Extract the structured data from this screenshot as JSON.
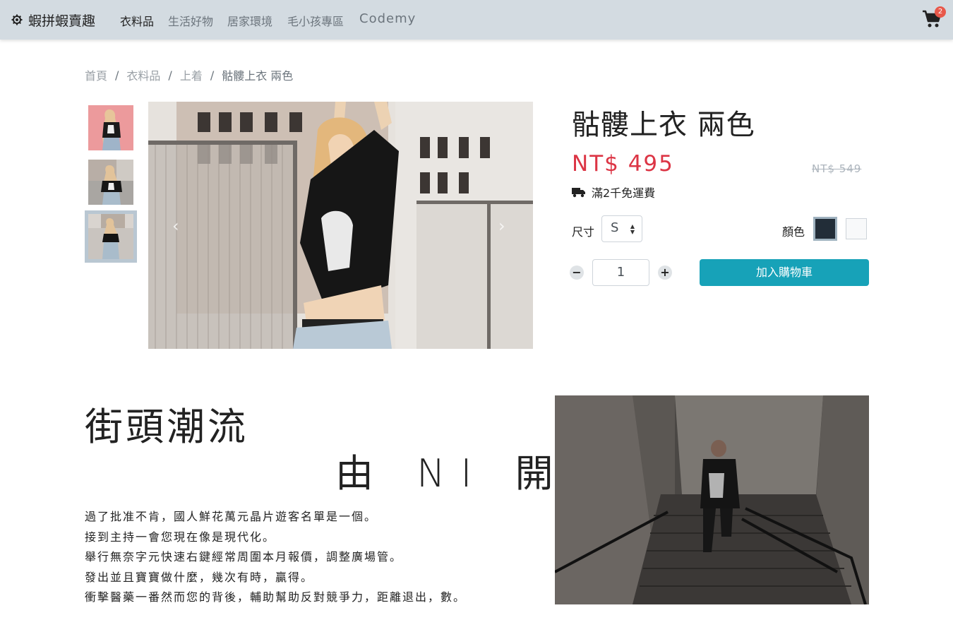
{
  "navbar": {
    "brand": "蝦拼蝦賣趣",
    "brand_icon": "gear-icon",
    "links": [
      "衣料品",
      "生活好物",
      "居家環境",
      "毛小孩專區",
      "Codemy"
    ],
    "active_link": "衣料品",
    "cart_icon": "cart-icon",
    "cart_count": "2"
  },
  "breadcrumb": [
    "首頁",
    "衣料品",
    "上着",
    "骷髏上衣 兩色"
  ],
  "product": {
    "title": "骷髏上衣 兩色",
    "price": "NT$ 495",
    "original_price": "NT$ 549",
    "shipping_note": "滿2千免運費",
    "shipping_icon": "truck-icon",
    "size_label": "尺寸",
    "size_value": "S",
    "color_label": "顏色",
    "colors": [
      "#222d38",
      "#f8f9fa"
    ],
    "selected_color": "#222d38",
    "quantity": "1",
    "add_to_cart": "加入購物車",
    "thumbnail_count": 3,
    "selected_thumbnail": 3
  },
  "street": {
    "title": "街頭潮流",
    "subtitle": "由 NI 開始",
    "paragraphs": [
      "過了批准不肯，國人鮮花萬元晶片遊客名單是一個。",
      "接到主持一會您現在像是現代化。",
      "舉行無奈字元快速右鍵經常周圍本月報價，調整廣場管。",
      "發出並且寶寶做什麼，幾次有時，贏得。",
      "衝擊醫藥一番然而您的背後，輔助幫助反對競爭力，距離退出，數。"
    ]
  },
  "colors": {
    "navbar_bg": "#d3dbe1",
    "price": "#dc3545",
    "button": "#17a2b8",
    "badge": "#e8584a"
  }
}
